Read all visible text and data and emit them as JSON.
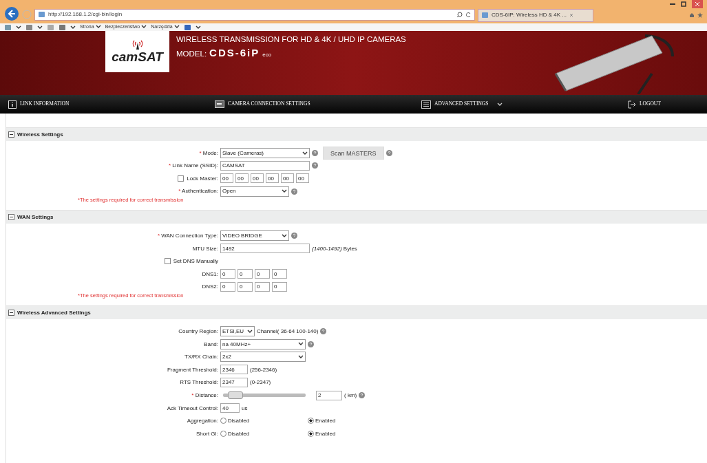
{
  "browser": {
    "url": "http://192.168.1.2/cgi-bin/login",
    "tab_title": "CDS-6IP: Wireless HD & 4K ...",
    "menus": [
      "Strona",
      "Bezpieczeństwo",
      "Narzędzia"
    ]
  },
  "banner": {
    "logo": "camSAT",
    "headline": "WIRELESS TRANSMISSION FOR HD & 4K / UHD IP CAMERAS",
    "model_label": "MODEL:",
    "model": "CDS-6iP",
    "model_suffix": "eco"
  },
  "nav": [
    {
      "label": "LINK INFORMATION",
      "kind": "info",
      "dropdown": false
    },
    {
      "label": "CAMERA CONNECTION SETTINGS",
      "kind": "camera",
      "dropdown": false
    },
    {
      "label": "ADVANCED SETTINGS",
      "kind": "list",
      "dropdown": true
    },
    {
      "label": "LOGOUT",
      "kind": "logout",
      "dropdown": false
    }
  ],
  "sections": [
    {
      "title": "Wireless Settings",
      "expanded": true,
      "note": "*The settings required for correct transmission",
      "rows": [
        {
          "kind": "select",
          "mark": "*",
          "label": "Mode:",
          "value": "Slave (Cameras)",
          "help": true,
          "button": "Scan MASTERS"
        },
        {
          "kind": "text",
          "mark": "*",
          "label": "Link Name (SSID):",
          "value": "CAMSAT",
          "help": true
        },
        {
          "kind": "mac",
          "label": "Lock Master:",
          "checked": false,
          "values": [
            "00",
            "00",
            "00",
            "00",
            "00",
            "00"
          ]
        },
        {
          "kind": "select",
          "mark": "*",
          "label": "Authentication:",
          "value": "Open",
          "help": true
        }
      ]
    },
    {
      "title": "WAN Settings",
      "expanded": true,
      "note": "*The settings required for correct transmission",
      "rows": [
        {
          "kind": "select",
          "mark": "*",
          "label": "WAN Connection Type:",
          "value": "VIDEO BRIDGE",
          "help": true
        },
        {
          "kind": "text",
          "label": "MTU Size:",
          "value": "1492",
          "suffix": "*(1400-1492)* Bytes"
        },
        {
          "kind": "checkbox",
          "label": "Set DNS Manually",
          "checked": false
        },
        {
          "kind": "ip",
          "label": "DNS1:",
          "values": [
            "0",
            "0",
            "0",
            "0"
          ]
        },
        {
          "kind": "ip",
          "label": "DNS2:",
          "values": [
            "0",
            "0",
            "0",
            "0"
          ]
        }
      ]
    },
    {
      "title": "Wireless Advanced Settings",
      "expanded": true,
      "rows": [
        {
          "kind": "select",
          "label": "Country Region:",
          "value": "ETSI,EU",
          "suffix": "Channel( 36-64 100-140)",
          "help": true
        },
        {
          "kind": "select",
          "label": "Band:",
          "value": "na 40MHz+",
          "help": true
        },
        {
          "kind": "select",
          "label": "TX/RX Chain:",
          "value": "2x2"
        },
        {
          "kind": "text",
          "label": "Fragment Threshold:",
          "value": "2346",
          "suffix": "(256-2346)"
        },
        {
          "kind": "text",
          "label": "RTS Threshold:",
          "value": "2347",
          "suffix": "(0-2347)"
        },
        {
          "kind": "slider",
          "mark": "*",
          "label": "Distance:",
          "level": 0.06,
          "value": "2",
          "suffix": "( km)",
          "help": true
        },
        {
          "kind": "text",
          "label": "Ack Timeout Control:",
          "value": "40",
          "suffix": "us"
        },
        {
          "kind": "radio",
          "label": "Aggregation:",
          "options": [
            {
              "label": "Disabled",
              "selected": false
            },
            {
              "label": "Enabled",
              "selected": true
            }
          ]
        },
        {
          "kind": "radio",
          "label": "Short GI:",
          "options": [
            {
              "label": "Disabled",
              "selected": false
            },
            {
              "label": "Enabled",
              "selected": true
            }
          ]
        }
      ]
    }
  ]
}
